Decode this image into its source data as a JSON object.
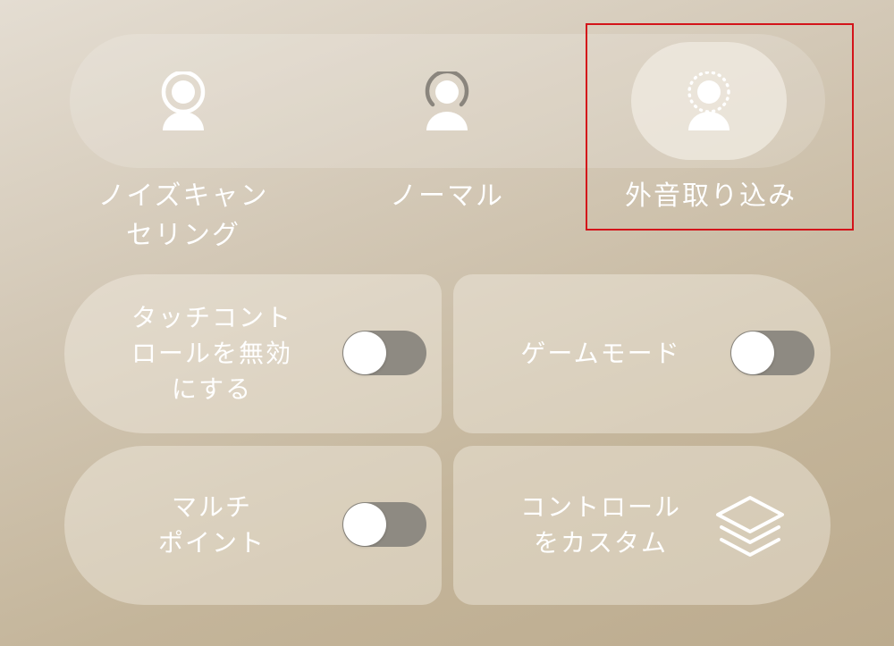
{
  "modes": [
    {
      "label": "ノイズキャン\nセリング",
      "icon": "noise-cancelling-icon",
      "selected": false
    },
    {
      "label": "ノーマル",
      "icon": "normal-mode-icon",
      "selected": false
    },
    {
      "label": "外音取り込み",
      "icon": "ambient-sound-icon",
      "selected": true
    }
  ],
  "tiles": {
    "touch_control": {
      "label": "タッチコント\nロールを無効\nにする",
      "toggle_on": false
    },
    "game_mode": {
      "label": "ゲームモード",
      "toggle_on": false
    },
    "multipoint": {
      "label": "マルチ\nポイント",
      "toggle_on": false
    },
    "customize": {
      "label": "コントロール\nをカスタム",
      "icon": "layers-icon"
    }
  },
  "colors": {
    "highlight": "#d3141a",
    "text": "#ffffff",
    "toggle_off_track": "#8e8a82"
  }
}
